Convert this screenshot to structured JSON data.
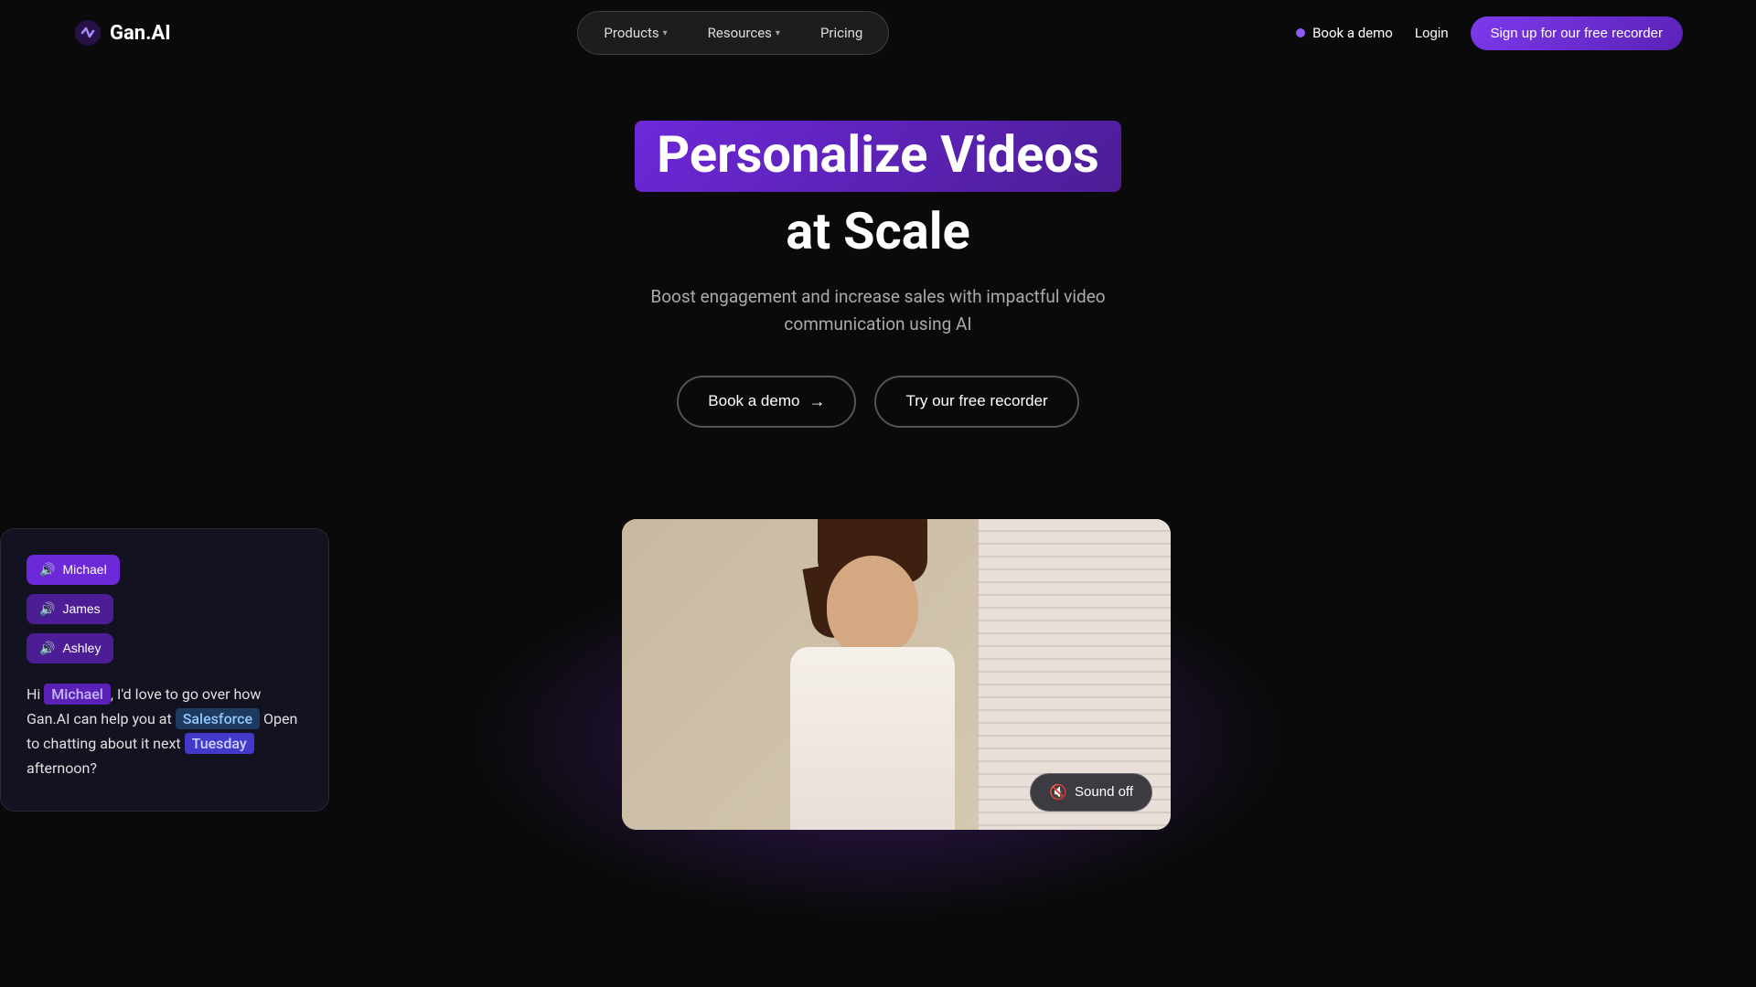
{
  "logo": {
    "text": "Gan.AI"
  },
  "nav": {
    "items": [
      {
        "label": "Products",
        "hasDropdown": true
      },
      {
        "label": "Resources",
        "hasDropdown": true
      },
      {
        "label": "Pricing",
        "hasDropdown": false
      }
    ],
    "book_demo": "Book a demo",
    "login": "Login",
    "signup": "Sign up for our free recorder"
  },
  "hero": {
    "title_highlight": "Personalize Videos",
    "title_main": "at Scale",
    "subtitle": "Boost engagement and increase sales with impactful video communication using AI",
    "btn_demo": "Book a demo",
    "btn_recorder": "Try our free recorder"
  },
  "persona_card": {
    "names": [
      {
        "label": "Michael",
        "active": true
      },
      {
        "label": "James",
        "active": false
      },
      {
        "label": "Ashley",
        "active": false
      }
    ],
    "text_pre": "Hi ",
    "name": "Michael",
    "text_mid": ", I'd love to go over how Gan.AI can help you at ",
    "company": "Salesforce",
    "text_post": " Open to chatting about it next ",
    "day": "Tuesday",
    "text_end": " afternoon?"
  },
  "video": {
    "sound_off_label": "Sound off"
  }
}
